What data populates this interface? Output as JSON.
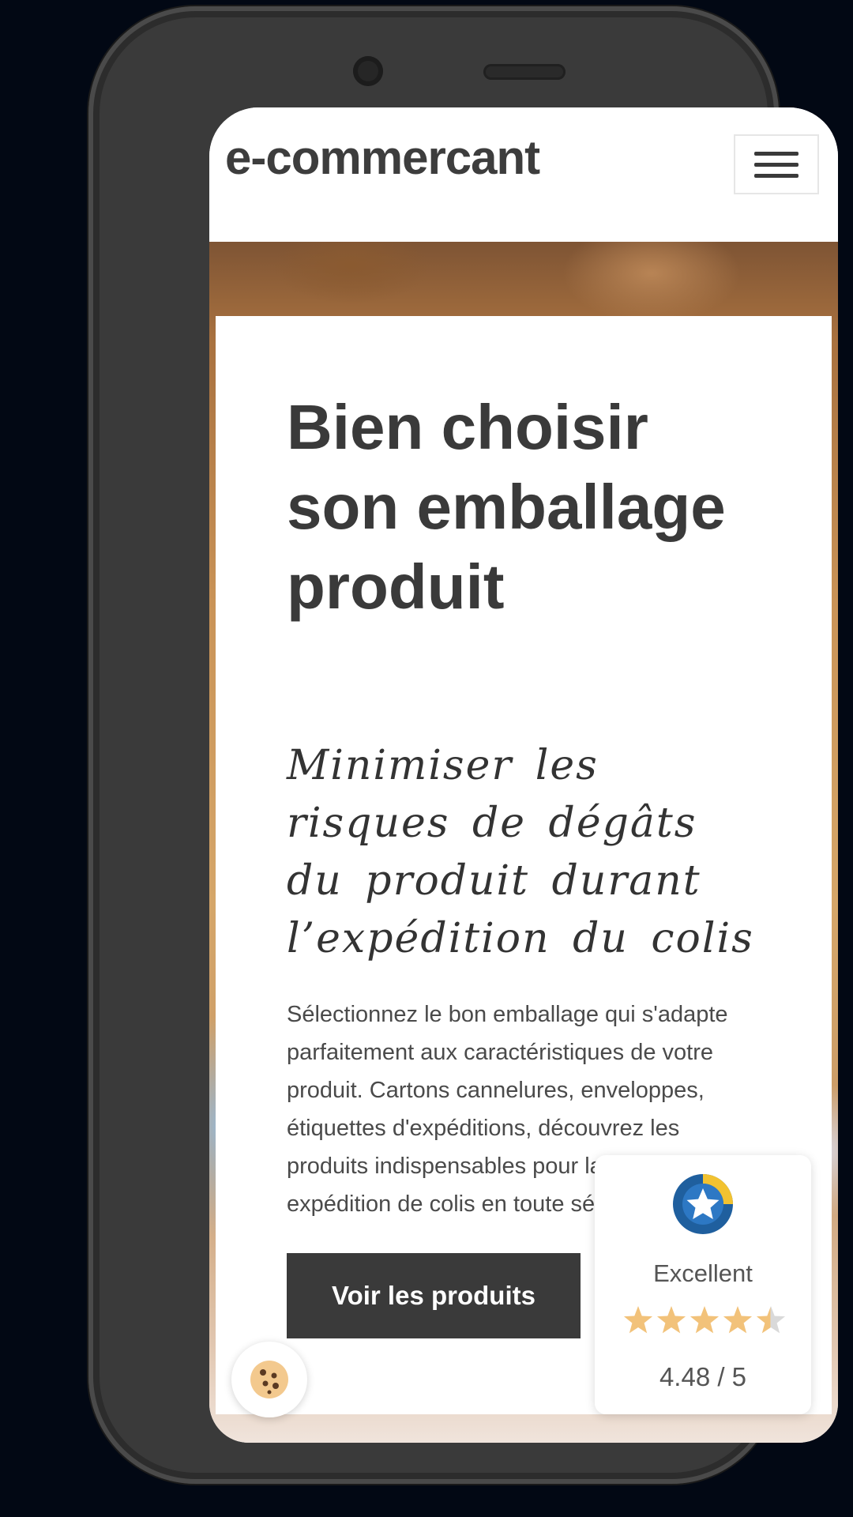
{
  "header": {
    "brand": "e-commercant",
    "menu_icon": "hamburger-icon"
  },
  "hero": {
    "title": "Bien choisir son emballage produit",
    "subtitle": "Minimiser les risques de dégâts du produit durant l’expédition du colis",
    "body": "Sélectionnez le bon emballage qui s'adapte parfaitement aux caractéristiques de votre produit. Cartons cannelures, enveloppes, étiquettes d'expéditions, découvrez les produits indispensables pour la réussite d'une expédition de colis en toute sécurité.",
    "cta_label": "Voir les produits"
  },
  "cookie_button": {
    "icon": "cookie-icon"
  },
  "rating_widget": {
    "logo_icon": "star-badge-icon",
    "label": "Excellent",
    "score": 4.48,
    "score_text": "4.48 / 5",
    "max_stars": 5,
    "star_color": "#f2c27a",
    "star_empty_color": "#d9d9d9"
  },
  "colors": {
    "text_dark": "#3a3a3a",
    "cta_background": "#3a3a3a",
    "logo_blue": "#1f5f9e",
    "logo_yellow": "#f2c230"
  }
}
